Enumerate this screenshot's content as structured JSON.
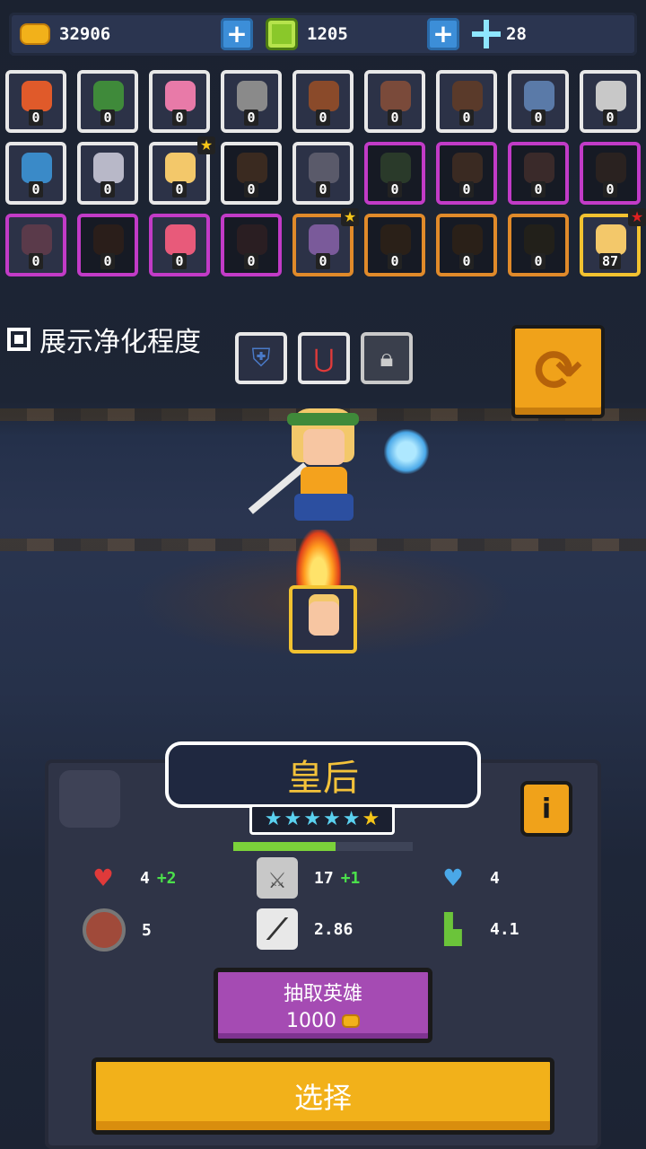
{
  "resources": {
    "coins": "32906",
    "gems": "1205",
    "crystals": "28"
  },
  "heroes": [
    {
      "count": "0",
      "frame": "white",
      "color": "#e05a2a"
    },
    {
      "count": "0",
      "frame": "white",
      "color": "#3f8a3a"
    },
    {
      "count": "0",
      "frame": "white",
      "color": "#e87aa8"
    },
    {
      "count": "0",
      "frame": "white",
      "color": "#8a8a8a"
    },
    {
      "count": "0",
      "frame": "white",
      "color": "#8a4a2a"
    },
    {
      "count": "0",
      "frame": "white",
      "color": "#7a4a3a"
    },
    {
      "count": "0",
      "frame": "white",
      "color": "#5a3a2a"
    },
    {
      "count": "0",
      "frame": "white",
      "color": "#5a7aa8"
    },
    {
      "count": "0",
      "frame": "white",
      "color": "#c8c8c8"
    },
    {
      "count": "0",
      "frame": "white",
      "color": "#3a8ac8"
    },
    {
      "count": "0",
      "frame": "white",
      "color": "#b8b8c8"
    },
    {
      "count": "0",
      "frame": "white",
      "color": "#f3c86a",
      "star": "yellow"
    },
    {
      "count": "0",
      "frame": "white",
      "color": "#3a2a20",
      "dark": true
    },
    {
      "count": "0",
      "frame": "white",
      "color": "#5a5a6a"
    },
    {
      "count": "0",
      "frame": "purple",
      "color": "#2a3a2a",
      "dark": true
    },
    {
      "count": "0",
      "frame": "purple",
      "color": "#3a2a22",
      "dark": true
    },
    {
      "count": "0",
      "frame": "purple",
      "color": "#3a2a2a",
      "dark": true
    },
    {
      "count": "0",
      "frame": "purple",
      "color": "#2a2220",
      "dark": true
    },
    {
      "count": "0",
      "frame": "purple",
      "color": "#5a3a4a"
    },
    {
      "count": "0",
      "frame": "purple",
      "color": "#2a1e1a",
      "dark": true
    },
    {
      "count": "0",
      "frame": "purple",
      "color": "#e85a7a"
    },
    {
      "count": "0",
      "frame": "purple",
      "color": "#2a1e22",
      "dark": true
    },
    {
      "count": "0",
      "frame": "orange",
      "color": "#7a5a9a",
      "star": "yellow"
    },
    {
      "count": "0",
      "frame": "orange",
      "color": "#2a2018",
      "dark": true
    },
    {
      "count": "0",
      "frame": "orange",
      "color": "#2a2018",
      "dark": true
    },
    {
      "count": "0",
      "frame": "orange",
      "color": "#22201a",
      "dark": true
    },
    {
      "count": "87",
      "frame": "gold",
      "color": "#f3c86a",
      "star": "red"
    }
  ],
  "show_purify_label": "展示净化程度",
  "side_buttons": [
    "shield-badge",
    "magnet",
    "lock"
  ],
  "selected_hero": {
    "name": "皇后",
    "stars_blue": 5,
    "stars_gold": 1,
    "xp_fraction": 0.57,
    "stats": {
      "hp": "4",
      "hp_bonus": "+2",
      "attack": "17",
      "attack_bonus": "+1",
      "armor": "4",
      "energy": "5",
      "crit": "2.86",
      "speed": "4.1"
    }
  },
  "draw_button": {
    "label": "抽取英雄",
    "cost": "1000"
  },
  "select_button": "选择"
}
